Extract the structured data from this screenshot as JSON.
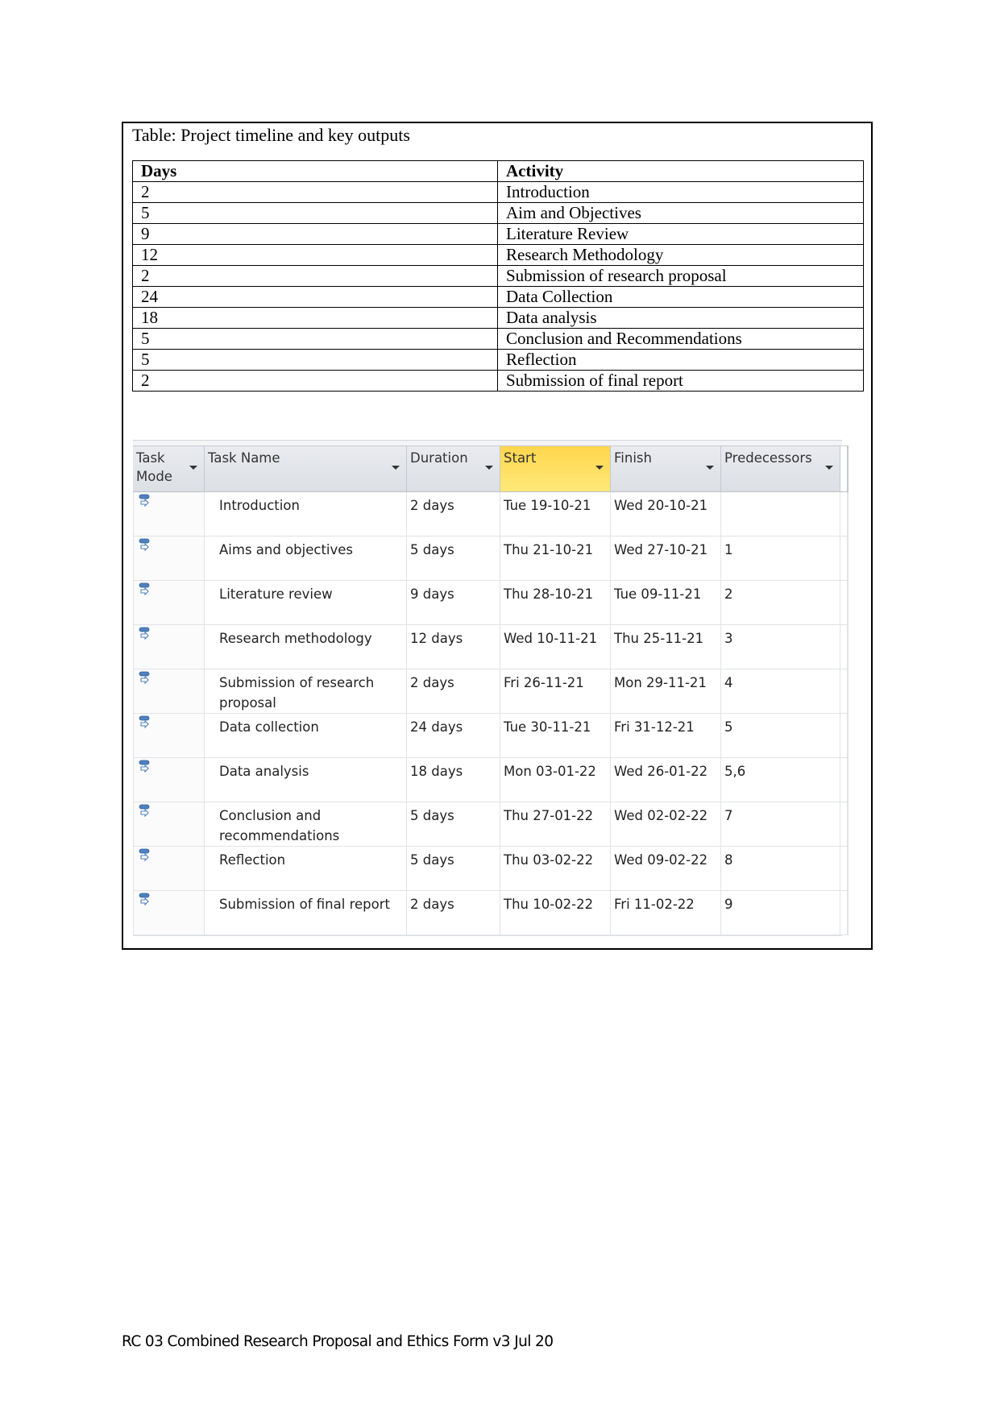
{
  "caption": "Table: Project timeline and key outputs",
  "timeline_table": {
    "headers": {
      "days": "Days",
      "activity": "Activity"
    },
    "rows": [
      {
        "days": "2",
        "activity": "Introduction"
      },
      {
        "days": "5",
        "activity": "Aim and Objectives"
      },
      {
        "days": "9",
        "activity": "Literature Review"
      },
      {
        "days": "12",
        "activity": "Research Methodology"
      },
      {
        "days": "2",
        "activity": "Submission of research proposal"
      },
      {
        "days": "24",
        "activity": "Data Collection"
      },
      {
        "days": "18",
        "activity": "Data analysis"
      },
      {
        "days": "5",
        "activity": "Conclusion and Recommendations"
      },
      {
        "days": "5",
        "activity": "Reflection"
      },
      {
        "days": "2",
        "activity": "Submission of final report"
      }
    ]
  },
  "project_grid": {
    "columns": {
      "task_mode": "Task Mode",
      "task_name": "Task Name",
      "duration": "Duration",
      "start": "Start",
      "finish": "Finish",
      "predecessors": "Predecessors"
    },
    "highlight_color": "#ffe066",
    "task_mode_icon": "auto-scheduled-task-icon",
    "rows": [
      {
        "name": "Introduction",
        "duration": "2 days",
        "start": "Tue 19-10-21",
        "finish": "Wed 20-10-21",
        "predecessors": ""
      },
      {
        "name": "Aims and objectives",
        "duration": "5 days",
        "start": "Thu 21-10-21",
        "finish": "Wed 27-10-21",
        "predecessors": "1"
      },
      {
        "name": "Literature review",
        "duration": "9 days",
        "start": "Thu 28-10-21",
        "finish": "Tue 09-11-21",
        "predecessors": "2"
      },
      {
        "name": "Research methodology",
        "duration": "12 days",
        "start": "Wed 10-11-21",
        "finish": "Thu 25-11-21",
        "predecessors": "3"
      },
      {
        "name": "Submission of research proposal",
        "duration": "2 days",
        "start": "Fri 26-11-21",
        "finish": "Mon 29-11-21",
        "predecessors": "4"
      },
      {
        "name": "Data collection",
        "duration": "24 days",
        "start": "Tue 30-11-21",
        "finish": "Fri 31-12-21",
        "predecessors": "5"
      },
      {
        "name": "Data analysis",
        "duration": "18 days",
        "start": "Mon 03-01-22",
        "finish": "Wed 26-01-22",
        "predecessors": "5,6"
      },
      {
        "name": "Conclusion and recommendations",
        "duration": "5 days",
        "start": "Thu 27-01-22",
        "finish": "Wed 02-02-22",
        "predecessors": "7"
      },
      {
        "name": "Reflection",
        "duration": "5 days",
        "start": "Thu 03-02-22",
        "finish": "Wed 09-02-22",
        "predecessors": "8"
      },
      {
        "name": "Submission of final report",
        "duration": "2 days",
        "start": "Thu 10-02-22",
        "finish": "Fri 11-02-22",
        "predecessors": "9"
      }
    ]
  },
  "footer": "RC 03 Combined Research Proposal and Ethics Form v3 Jul 20"
}
